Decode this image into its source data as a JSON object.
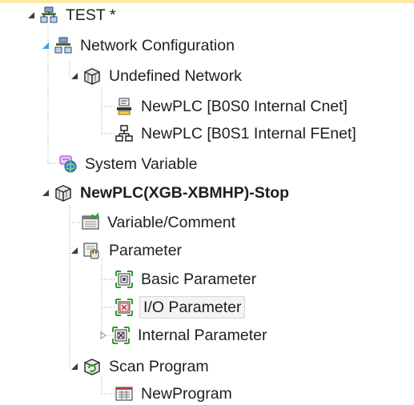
{
  "tree": {
    "project": {
      "label": "TEST *",
      "icon": "project-icon"
    },
    "network_config": {
      "label": "Network Configuration",
      "icon": "network-config-icon"
    },
    "undefined_network": {
      "label": "Undefined Network",
      "icon": "network-cube-icon"
    },
    "cnet": {
      "label": "NewPLC [B0S0 Internal Cnet]",
      "icon": "cnet-module-icon"
    },
    "fenet": {
      "label": "NewPLC [B0S1 Internal FEnet]",
      "icon": "fenet-module-icon"
    },
    "system_variable": {
      "label": "System Variable",
      "icon": "system-variable-icon"
    },
    "plc": {
      "label": "NewPLC(XGB-XBMHP)-Stop",
      "icon": "plc-cube-icon"
    },
    "variable_comment": {
      "label": "Variable/Comment",
      "icon": "variable-comment-icon"
    },
    "parameter": {
      "label": "Parameter",
      "icon": "parameter-hand-icon"
    },
    "basic_parameter": {
      "label": "Basic Parameter",
      "icon": "basic-parameter-icon"
    },
    "io_parameter": {
      "label": "I/O Parameter",
      "icon": "io-parameter-icon",
      "selected": true
    },
    "internal_parameter": {
      "label": "Internal Parameter",
      "icon": "internal-parameter-icon"
    },
    "scan_program": {
      "label": "Scan Program",
      "icon": "scan-program-icon"
    },
    "new_program": {
      "label": "NewProgram",
      "icon": "program-icon"
    }
  },
  "colors": {
    "tree_line": "#a0a0a0",
    "expanded_arrow": "#3c3c3c",
    "collapsed_arrow": "#8c8c8c",
    "selected_arrow": "#3aa0e0",
    "header_band": "#fde9a6"
  }
}
